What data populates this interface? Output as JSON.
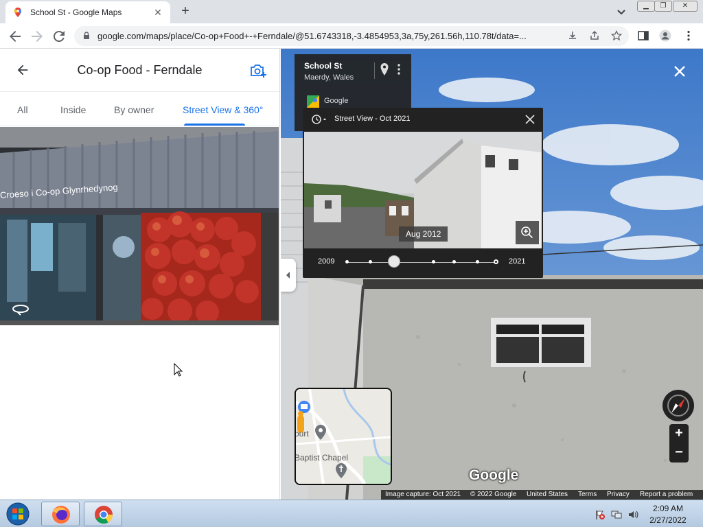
{
  "browser": {
    "tab_title": "School St - Google Maps",
    "url": "google.com/maps/place/Co-op+Food+-+Ferndale/@51.6743318,-3.4854953,3a,75y,261.56h,110.78t/data=..."
  },
  "left_panel": {
    "title": "Co-op Food - Ferndale",
    "tabs": [
      "All",
      "Inside",
      "By owner",
      "Street View & 360°"
    ],
    "active_tab": "Street View & 360°",
    "photo_sign_text": "Croeso i Co-op Glynrhedynog"
  },
  "street_view": {
    "info_card": {
      "street": "School St",
      "locality": "Maerdy, Wales",
      "source": "Google"
    },
    "time_machine": {
      "title": "Street View - Oct 2021",
      "preview_date": "Aug 2012",
      "start_year": "2009",
      "end_year": "2021"
    },
    "minimap_labels": [
      "ourt",
      "Baptist Chapel"
    ],
    "watermark": "Google",
    "footer": [
      "Image capture: Oct 2021",
      "© 2022 Google",
      "United States",
      "Terms",
      "Privacy",
      "Report a problem"
    ]
  },
  "taskbar": {
    "time": "2:09 AM",
    "date": "2/27/2022"
  },
  "colors": {
    "accent": "#1a73e8",
    "panel_dark": "#222222"
  },
  "icons": [
    "maps-favicon",
    "back-icon",
    "forward-icon",
    "reload-icon",
    "lock-icon",
    "install-icon",
    "share-icon",
    "star-icon",
    "sidepanel-icon",
    "profile-icon",
    "menu-icon",
    "add-photo-icon",
    "rotate-360-icon",
    "pin-icon",
    "more-vert-icon",
    "history-clock-icon",
    "close-icon",
    "zoom-in-icon",
    "compass-icon",
    "windows-start-icon",
    "firefox-icon",
    "chrome-icon"
  ]
}
